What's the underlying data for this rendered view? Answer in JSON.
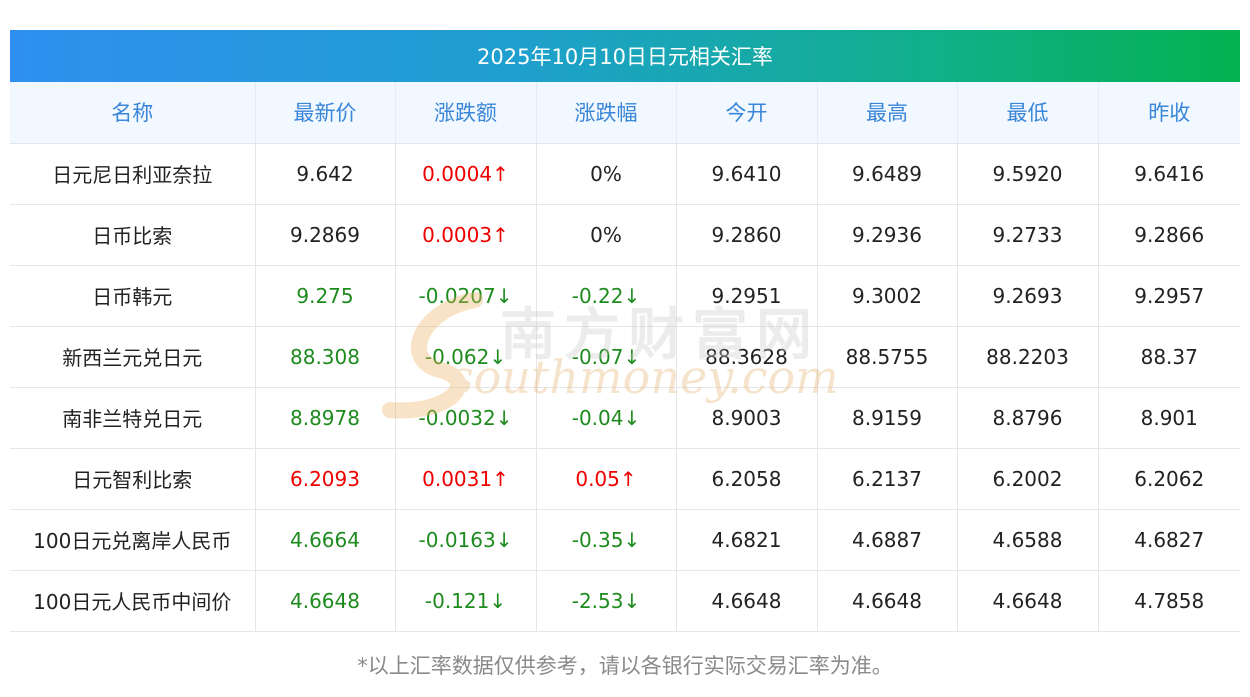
{
  "title": "2025年10月10日日元相关汇率",
  "headers": [
    "名称",
    "最新价",
    "涨跌额",
    "涨跌幅",
    "今开",
    "最高",
    "最低",
    "昨收"
  ],
  "rows": [
    {
      "name": "日元尼日利亚奈拉",
      "latest": "9.642",
      "latest_color": "black",
      "change": "0.0004↑",
      "change_color": "red",
      "pct": "0%",
      "pct_color": "black",
      "open": "9.6410",
      "high": "9.6489",
      "low": "9.5920",
      "prev": "9.6416"
    },
    {
      "name": "日币比索",
      "latest": "9.2869",
      "latest_color": "black",
      "change": "0.0003↑",
      "change_color": "red",
      "pct": "0%",
      "pct_color": "black",
      "open": "9.2860",
      "high": "9.2936",
      "low": "9.2733",
      "prev": "9.2866"
    },
    {
      "name": "日币韩元",
      "latest": "9.275",
      "latest_color": "green",
      "change": "-0.0207↓",
      "change_color": "green",
      "pct": "-0.22↓",
      "pct_color": "green",
      "open": "9.2951",
      "high": "9.3002",
      "low": "9.2693",
      "prev": "9.2957"
    },
    {
      "name": "新西兰元兑日元",
      "latest": "88.308",
      "latest_color": "green",
      "change": "-0.062↓",
      "change_color": "green",
      "pct": "-0.07↓",
      "pct_color": "green",
      "open": "88.3628",
      "high": "88.5755",
      "low": "88.2203",
      "prev": "88.37"
    },
    {
      "name": "南非兰特兑日元",
      "latest": "8.8978",
      "latest_color": "green",
      "change": "-0.0032↓",
      "change_color": "green",
      "pct": "-0.04↓",
      "pct_color": "green",
      "open": "8.9003",
      "high": "8.9159",
      "low": "8.8796",
      "prev": "8.901"
    },
    {
      "name": "日元智利比索",
      "latest": "6.2093",
      "latest_color": "red",
      "change": "0.0031↑",
      "change_color": "red",
      "pct": "0.05↑",
      "pct_color": "red",
      "open": "6.2058",
      "high": "6.2137",
      "low": "6.2002",
      "prev": "6.2062"
    },
    {
      "name": "100日元兑离岸人民币",
      "latest": "4.6664",
      "latest_color": "green",
      "change": "-0.0163↓",
      "change_color": "green",
      "pct": "-0.35↓",
      "pct_color": "green",
      "open": "4.6821",
      "high": "4.6887",
      "low": "4.6588",
      "prev": "4.6827"
    },
    {
      "name": "100日元人民币中间价",
      "latest": "4.6648",
      "latest_color": "green",
      "change": "-0.121↓",
      "change_color": "green",
      "pct": "-2.53↓",
      "pct_color": "green",
      "open": "4.6648",
      "high": "4.6648",
      "low": "4.6648",
      "prev": "4.7858"
    }
  ],
  "footer_note": "*以上汇率数据仅供参考，请以各银行实际交易汇率为准。",
  "watermark": {
    "cn": "南方财富网",
    "en": "southmoney.com"
  },
  "colors": {
    "up": "#ee0000",
    "down": "#1e8b1e",
    "header_text": "#3a86d8",
    "header_bg": "#f1f8ff",
    "title_gradient_start": "#2f8ff0",
    "title_gradient_end": "#05b150"
  }
}
